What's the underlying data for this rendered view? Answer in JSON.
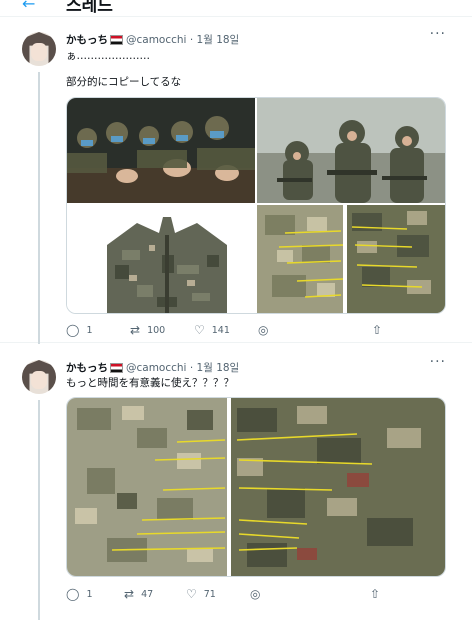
{
  "header": {
    "back_icon": "arrow-left-icon",
    "title": "스레드"
  },
  "tweets": [
    {
      "author": {
        "name": "かもっち",
        "flag_icon": "iraq-flag-icon",
        "handle": "@camocchi",
        "separator": "·",
        "date": "1월 18일"
      },
      "more_icon": "more-icon",
      "text_lines": [
        "ぁ…………………",
        "部分的にコピーしてるな"
      ],
      "media_count": 4,
      "actions": {
        "reply_count": "1",
        "retweet_count": "100",
        "like_count": "141"
      }
    },
    {
      "author": {
        "name": "かもっち",
        "flag_icon": "iraq-flag-icon",
        "handle": "@camocchi",
        "separator": "·",
        "date": "1월 18일"
      },
      "more_icon": "more-icon",
      "text_lines": [
        "もっと時間を有意義に使え？？？？"
      ],
      "media_count": 1,
      "actions": {
        "reply_count": "1",
        "retweet_count": "47",
        "like_count": "71"
      }
    }
  ],
  "colors": {
    "accent": "#1d9bf0",
    "secondary_text": "#536471",
    "border": "#eff3f4",
    "annotation_line": "#e8d92a"
  }
}
